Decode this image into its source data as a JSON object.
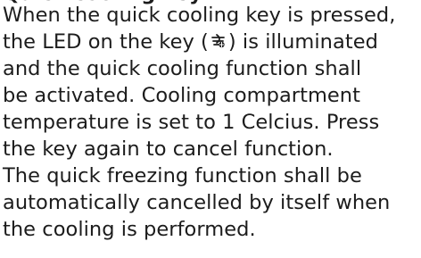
{
  "document": {
    "heading_partial": "Quick cooling key",
    "lines": [
      "When the quick cooling key is pressed,",
      "the LED on the key (",
      ") is illuminated",
      "and the quick cooling function shall",
      "be activated. Cooling compartment",
      "temperature is set to 1 Celcius. Press",
      "the key again to cancel function.",
      "The quick freezing function shall be",
      "automatically cancelled by itself when",
      "the cooling is performed."
    ],
    "icon": "quick-cooling-fan-icon"
  }
}
